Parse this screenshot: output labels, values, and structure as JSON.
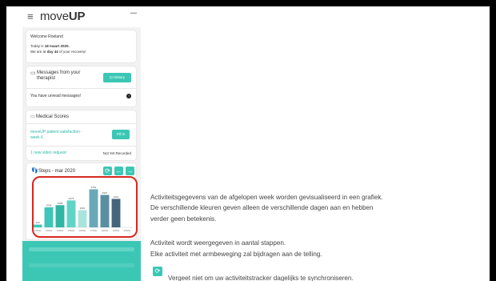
{
  "app": {
    "menu_icon": "hamburger-menu-icon",
    "logo_prefix": "move",
    "logo_bold": "UP"
  },
  "welcome": {
    "greeting": "Welcome Roeland",
    "today_prefix": "Today is ",
    "today_date": "18 maart 2020.",
    "recovery_prefix": "We are at ",
    "recovery_day": "day 44",
    "recovery_suffix": " of your recovery!"
  },
  "messages": {
    "title_line1": "Messages from your",
    "title_line2": "therapist",
    "history_label": "History",
    "unread_text": "You have unread messages!"
  },
  "medical": {
    "title": "Medical Scores",
    "survey_line1": "moveUP patient satisfaction -",
    "survey_line2": "week 6",
    "fill_label": "Fill in",
    "video_request": "1 new video request",
    "video_status": "Not Yet Recorded"
  },
  "steps": {
    "label": "Steps",
    "date": "- mar 2020"
  },
  "chart_data": {
    "type": "bar",
    "categories": [
      "12/Mar",
      "13/Mar",
      "14/Mar",
      "15/Mar",
      "16/Mar",
      "17/Mar",
      "18/Mar",
      "19/Mar",
      "20/Mar"
    ],
    "values": [
      420,
      3038,
      3358,
      4079,
      2601,
      5762,
      4907,
      4310,
      0
    ],
    "value_labels": [
      "420",
      "3038",
      "3358",
      "4079",
      "2601",
      "5762",
      "4907",
      "4310",
      ""
    ],
    "colors": [
      "#3fc6b6",
      "#3fc6b6",
      "#2fb6a4",
      "#5fd4c6",
      "#a9e4dc",
      "#6aa8b8",
      "#5b8ea1",
      "#45657d",
      "#c9e8e3"
    ],
    "ylim": [
      0,
      6300
    ]
  },
  "description": {
    "line1": "Activiteitsgegevens van de afgelopen week worden gevisualiseerd in een grafiek.",
    "line2": "De verschillende kleuren geven alleen de verschillende dagen aan en hebben",
    "line3": "verder geen betekenis.",
    "line4": "Activiteit wordt weergegeven in aantal stappen.",
    "line5": "Elke activiteit met armbeweging zal bijdragen aan de telling.",
    "line6": "Vergeet niet om uw activiteitstracker dagelijks te synchroniseren."
  }
}
